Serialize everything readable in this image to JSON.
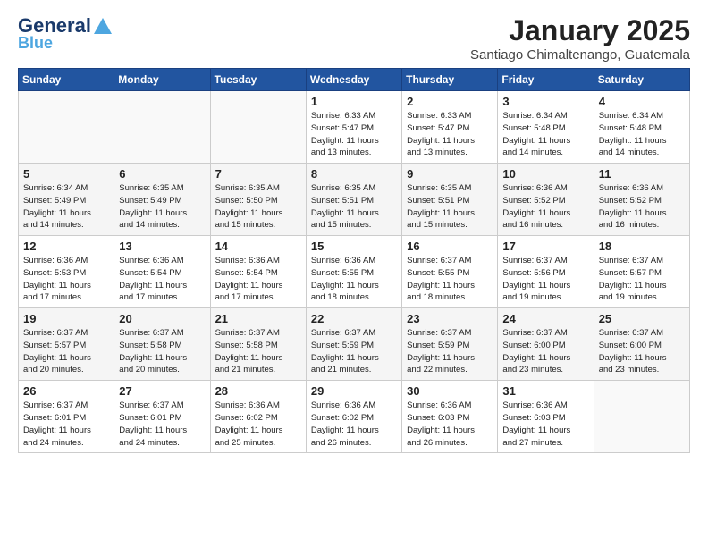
{
  "logo": {
    "line1": "General",
    "line2": "Blue"
  },
  "header": {
    "month": "January 2025",
    "location": "Santiago Chimaltenango, Guatemala"
  },
  "weekdays": [
    "Sunday",
    "Monday",
    "Tuesday",
    "Wednesday",
    "Thursday",
    "Friday",
    "Saturday"
  ],
  "weeks": [
    [
      {
        "day": "",
        "info": ""
      },
      {
        "day": "",
        "info": ""
      },
      {
        "day": "",
        "info": ""
      },
      {
        "day": "1",
        "info": "Sunrise: 6:33 AM\nSunset: 5:47 PM\nDaylight: 11 hours\nand 13 minutes."
      },
      {
        "day": "2",
        "info": "Sunrise: 6:33 AM\nSunset: 5:47 PM\nDaylight: 11 hours\nand 13 minutes."
      },
      {
        "day": "3",
        "info": "Sunrise: 6:34 AM\nSunset: 5:48 PM\nDaylight: 11 hours\nand 14 minutes."
      },
      {
        "day": "4",
        "info": "Sunrise: 6:34 AM\nSunset: 5:48 PM\nDaylight: 11 hours\nand 14 minutes."
      }
    ],
    [
      {
        "day": "5",
        "info": "Sunrise: 6:34 AM\nSunset: 5:49 PM\nDaylight: 11 hours\nand 14 minutes."
      },
      {
        "day": "6",
        "info": "Sunrise: 6:35 AM\nSunset: 5:49 PM\nDaylight: 11 hours\nand 14 minutes."
      },
      {
        "day": "7",
        "info": "Sunrise: 6:35 AM\nSunset: 5:50 PM\nDaylight: 11 hours\nand 15 minutes."
      },
      {
        "day": "8",
        "info": "Sunrise: 6:35 AM\nSunset: 5:51 PM\nDaylight: 11 hours\nand 15 minutes."
      },
      {
        "day": "9",
        "info": "Sunrise: 6:35 AM\nSunset: 5:51 PM\nDaylight: 11 hours\nand 15 minutes."
      },
      {
        "day": "10",
        "info": "Sunrise: 6:36 AM\nSunset: 5:52 PM\nDaylight: 11 hours\nand 16 minutes."
      },
      {
        "day": "11",
        "info": "Sunrise: 6:36 AM\nSunset: 5:52 PM\nDaylight: 11 hours\nand 16 minutes."
      }
    ],
    [
      {
        "day": "12",
        "info": "Sunrise: 6:36 AM\nSunset: 5:53 PM\nDaylight: 11 hours\nand 17 minutes."
      },
      {
        "day": "13",
        "info": "Sunrise: 6:36 AM\nSunset: 5:54 PM\nDaylight: 11 hours\nand 17 minutes."
      },
      {
        "day": "14",
        "info": "Sunrise: 6:36 AM\nSunset: 5:54 PM\nDaylight: 11 hours\nand 17 minutes."
      },
      {
        "day": "15",
        "info": "Sunrise: 6:36 AM\nSunset: 5:55 PM\nDaylight: 11 hours\nand 18 minutes."
      },
      {
        "day": "16",
        "info": "Sunrise: 6:37 AM\nSunset: 5:55 PM\nDaylight: 11 hours\nand 18 minutes."
      },
      {
        "day": "17",
        "info": "Sunrise: 6:37 AM\nSunset: 5:56 PM\nDaylight: 11 hours\nand 19 minutes."
      },
      {
        "day": "18",
        "info": "Sunrise: 6:37 AM\nSunset: 5:57 PM\nDaylight: 11 hours\nand 19 minutes."
      }
    ],
    [
      {
        "day": "19",
        "info": "Sunrise: 6:37 AM\nSunset: 5:57 PM\nDaylight: 11 hours\nand 20 minutes."
      },
      {
        "day": "20",
        "info": "Sunrise: 6:37 AM\nSunset: 5:58 PM\nDaylight: 11 hours\nand 20 minutes."
      },
      {
        "day": "21",
        "info": "Sunrise: 6:37 AM\nSunset: 5:58 PM\nDaylight: 11 hours\nand 21 minutes."
      },
      {
        "day": "22",
        "info": "Sunrise: 6:37 AM\nSunset: 5:59 PM\nDaylight: 11 hours\nand 21 minutes."
      },
      {
        "day": "23",
        "info": "Sunrise: 6:37 AM\nSunset: 5:59 PM\nDaylight: 11 hours\nand 22 minutes."
      },
      {
        "day": "24",
        "info": "Sunrise: 6:37 AM\nSunset: 6:00 PM\nDaylight: 11 hours\nand 23 minutes."
      },
      {
        "day": "25",
        "info": "Sunrise: 6:37 AM\nSunset: 6:00 PM\nDaylight: 11 hours\nand 23 minutes."
      }
    ],
    [
      {
        "day": "26",
        "info": "Sunrise: 6:37 AM\nSunset: 6:01 PM\nDaylight: 11 hours\nand 24 minutes."
      },
      {
        "day": "27",
        "info": "Sunrise: 6:37 AM\nSunset: 6:01 PM\nDaylight: 11 hours\nand 24 minutes."
      },
      {
        "day": "28",
        "info": "Sunrise: 6:36 AM\nSunset: 6:02 PM\nDaylight: 11 hours\nand 25 minutes."
      },
      {
        "day": "29",
        "info": "Sunrise: 6:36 AM\nSunset: 6:02 PM\nDaylight: 11 hours\nand 26 minutes."
      },
      {
        "day": "30",
        "info": "Sunrise: 6:36 AM\nSunset: 6:03 PM\nDaylight: 11 hours\nand 26 minutes."
      },
      {
        "day": "31",
        "info": "Sunrise: 6:36 AM\nSunset: 6:03 PM\nDaylight: 11 hours\nand 27 minutes."
      },
      {
        "day": "",
        "info": ""
      }
    ]
  ]
}
